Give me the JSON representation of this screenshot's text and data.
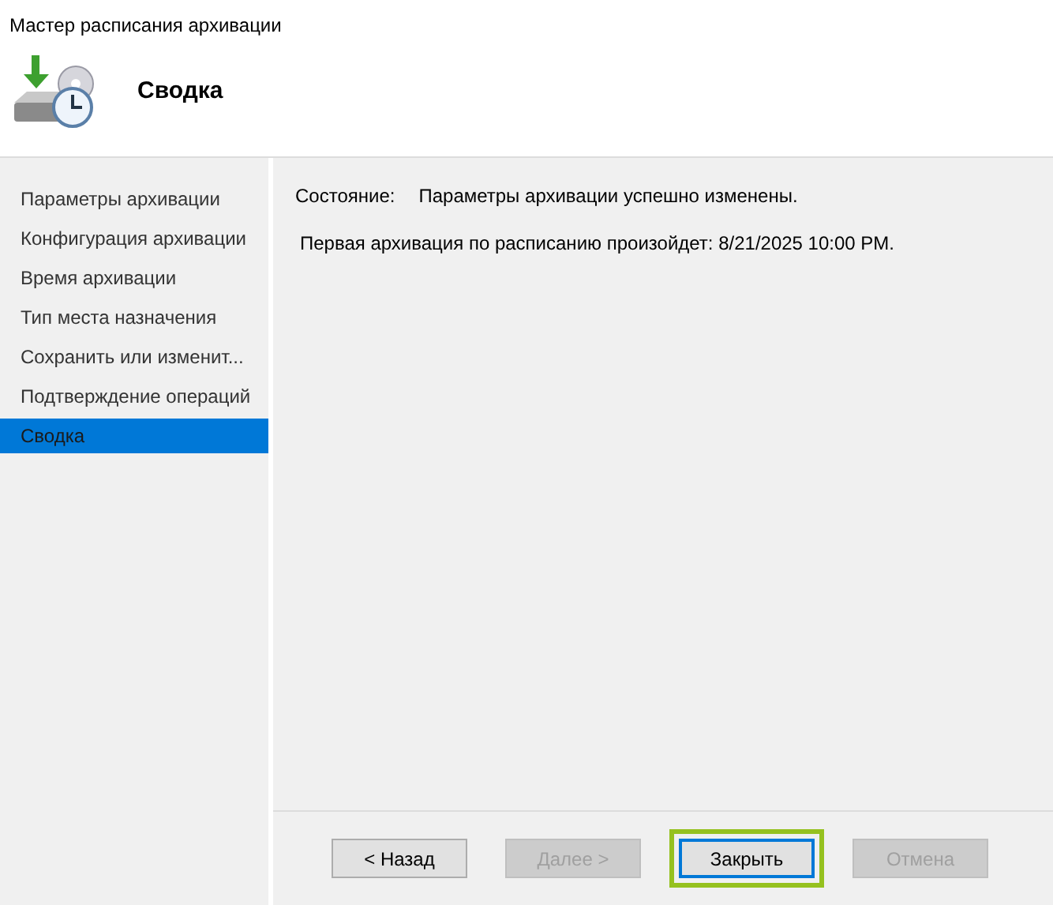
{
  "window": {
    "title": "Мастер расписания архивации"
  },
  "header": {
    "title": "Сводка"
  },
  "sidebar": {
    "items": [
      {
        "label": "Параметры архивации",
        "selected": false
      },
      {
        "label": "Конфигурация архивации",
        "selected": false
      },
      {
        "label": "Время архивации",
        "selected": false
      },
      {
        "label": "Тип места назначения",
        "selected": false
      },
      {
        "label": "Сохранить или изменит...",
        "selected": false
      },
      {
        "label": "Подтверждение операций",
        "selected": false
      },
      {
        "label": "Сводка",
        "selected": true
      }
    ]
  },
  "status": {
    "label": "Состояние:",
    "value": "Параметры архивации успешно изменены."
  },
  "message": "Первая архивация по расписанию произойдет: 8/21/2025 10:00 PM.",
  "buttons": [
    {
      "label": "< Назад",
      "disabled": false,
      "default": false,
      "highlighted": false
    },
    {
      "label": "Далее >",
      "disabled": true,
      "default": false,
      "highlighted": false
    },
    {
      "label": "Закрыть",
      "disabled": false,
      "default": true,
      "highlighted": true
    },
    {
      "label": "Отмена",
      "disabled": true,
      "default": false,
      "highlighted": false
    }
  ]
}
